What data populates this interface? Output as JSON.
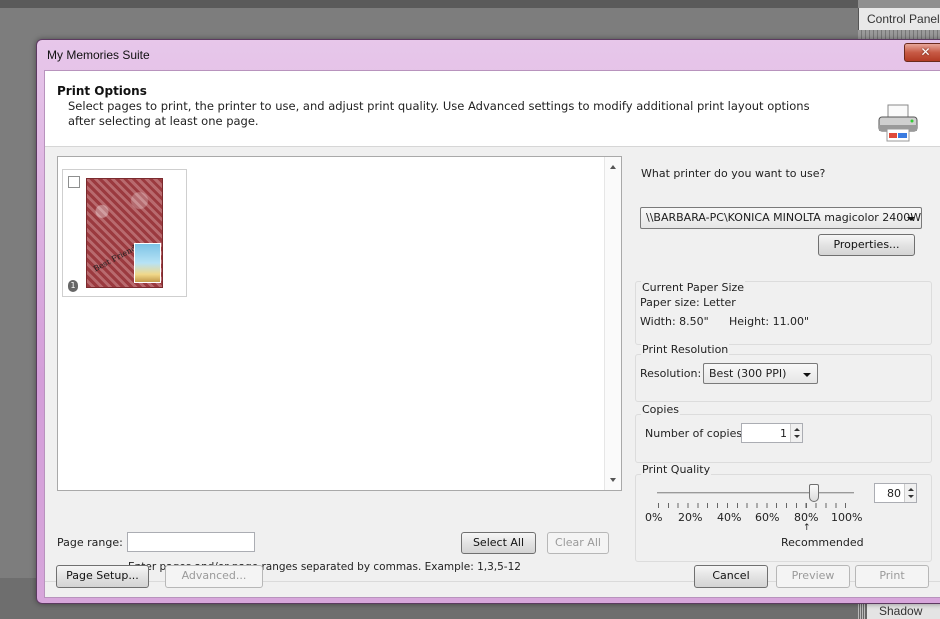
{
  "background": {
    "control_panel_label": "Control Panel",
    "shadow_label": "Shadow"
  },
  "window": {
    "title": "My Memories Suite",
    "close_icon": "close-icon"
  },
  "header": {
    "title": "Print Options",
    "description": "Select pages to print, the printer to use, and adjust print quality. Use Advanced settings to modify additional print layout options after selecting at least one page.",
    "icon": "printer-icon"
  },
  "preview": {
    "pages": [
      {
        "number": "1",
        "checked": false,
        "caption": "Best Friends"
      }
    ]
  },
  "page_range": {
    "label": "Page range:",
    "value": "",
    "hint": "Enter pages and/or page ranges separated by commas. Example: 1,3,5-12"
  },
  "buttons": {
    "select_all": "Select All",
    "clear_all": "Clear All",
    "page_setup": "Page Setup...",
    "advanced": "Advanced...",
    "cancel": "Cancel",
    "preview": "Preview",
    "print": "Print",
    "properties": "Properties..."
  },
  "printer": {
    "label": "What printer do you want to use?",
    "selected": "\\\\BARBARA-PC\\KONICA MINOLTA magicolor 2400W"
  },
  "paper": {
    "group_label": "Current Paper Size",
    "size_text": "Paper size: Letter",
    "width_text": "Width: 8.50\"",
    "height_text": "Height: 11.00\""
  },
  "resolution": {
    "group_label": "Print Resolution",
    "label": "Resolution:",
    "selected": "Best (300 PPI)"
  },
  "copies": {
    "group_label": "Copies",
    "label": "Number of copies:",
    "value": "1"
  },
  "quality": {
    "group_label": "Print Quality",
    "value": "80",
    "slider_fraction": 0.8,
    "tick_labels": [
      "0%",
      "20%",
      "40%",
      "60%",
      "80%",
      "100%"
    ],
    "recommended_label": "Recommended"
  }
}
